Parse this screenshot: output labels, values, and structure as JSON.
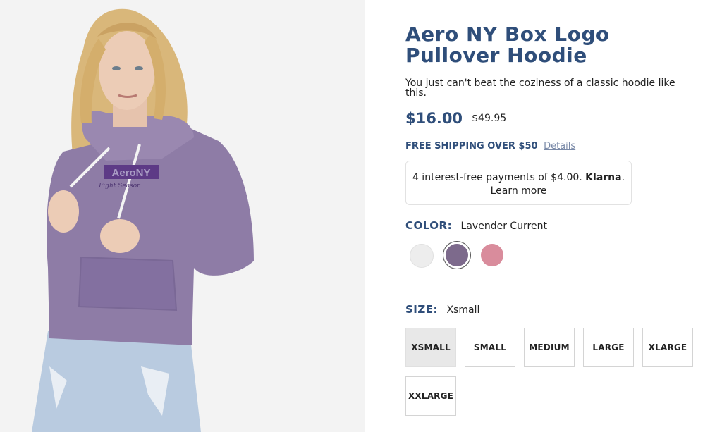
{
  "product": {
    "title": "Aero NY Box Logo Pullover Hoodie",
    "description": "You just can't beat the coziness of a classic hoodie like this.",
    "price": "$16.00",
    "original_price": "$49.95",
    "image_logo_text": "AeroNY",
    "image_script_text": "Fight Season"
  },
  "shipping": {
    "text": "FREE SHIPPING OVER $50",
    "link": "Details"
  },
  "klarna": {
    "text": "4 interest-free payments of $4.00.",
    "brand": "Klarna",
    "brand_suffix": ".",
    "link": "Learn more"
  },
  "color": {
    "label": "COLOR:",
    "selected": "Lavender Current",
    "swatches": [
      {
        "name": "White",
        "hex": "#ededed"
      },
      {
        "name": "Lavender Current",
        "hex": "#7d6a8c"
      },
      {
        "name": "Pink",
        "hex": "#d98c9c"
      }
    ]
  },
  "size": {
    "label": "SIZE:",
    "selected": "Xsmall",
    "options": [
      "XSMALL",
      "SMALL",
      "MEDIUM",
      "LARGE",
      "XLARGE",
      "XXLARGE"
    ]
  },
  "colors": {
    "brand": "#2f4e7a"
  }
}
